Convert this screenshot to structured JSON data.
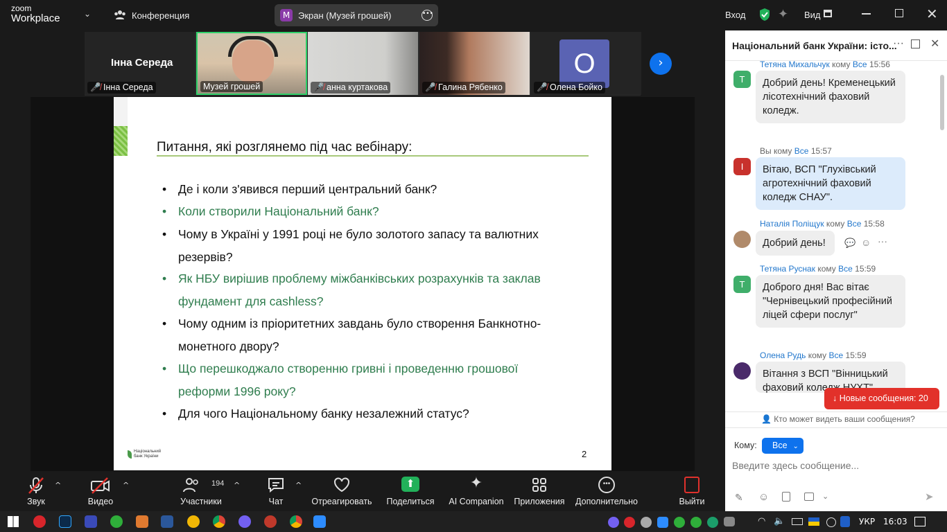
{
  "topbar": {
    "logo_line1": "zoom",
    "logo_line2": "Workplace",
    "conference": "Конференция",
    "share_badge": "M",
    "share_title": "Экран (Музей грошей)",
    "signin": "Вход",
    "view": "Вид"
  },
  "participants": [
    {
      "name": "Інна Середа",
      "display": "Інна Середа",
      "muted": true
    },
    {
      "name": "Музей грошей",
      "muted": false
    },
    {
      "name": "анна куртакова",
      "muted": true
    },
    {
      "name": "Галина Рябенко",
      "muted": true
    },
    {
      "name": "Олена Бойко",
      "initial": "О",
      "muted": true
    }
  ],
  "slide": {
    "title": "Питання, які розглянемо під час вебінару:",
    "bullets": [
      {
        "text": "Де і коли з'явився перший центральний банк?",
        "color": "#111111"
      },
      {
        "text": "Коли створили Національний банк?",
        "color": "#2f7d4e"
      },
      {
        "text": "Чому в Україні у 1991 році не було золотого запасу та валютних резервів?",
        "color": "#111111"
      },
      {
        "text": "Як НБУ вирішив проблему міжбанківських розрахунків та заклав фундамент для cashless?",
        "color": "#2f7d4e"
      },
      {
        "text": "Чому одним із пріоритетних завдань було створення Банкнотно-монетного двору?",
        "color": "#111111"
      },
      {
        "text": "Що перешкоджало створенню гривні і проведенню грошової реформи 1996 року?",
        "color": "#2f7d4e"
      },
      {
        "text": "Для чого Національному банку незалежний статус?",
        "color": "#111111"
      }
    ],
    "logo_text_1": "Національний",
    "logo_text_2": "банк України",
    "page_number": "2"
  },
  "chat": {
    "title": "Національний банк України: істо...",
    "messages": [
      {
        "sender": "Тетяна Михальчук",
        "to_word": "кому",
        "audience": "Все",
        "time": "15:56",
        "avatar": "T",
        "avatar_color": "#3fae6a",
        "text": "Добрий день! Кременецький лісотехнічний фаховий коледж."
      },
      {
        "sender": "Вы",
        "to_word": "кому",
        "audience": "Все",
        "time": "15:57",
        "avatar": "I",
        "avatar_color": "#c8312c",
        "text": "Вітаю, ВСП \"Глухівський агротехнічний фаховий коледж СНАУ\"."
      },
      {
        "sender": "Наталія Поліщук",
        "to_word": "кому",
        "audience": "Все",
        "time": "15:58",
        "avatar": "",
        "avatar_color": "#b08a6a",
        "text": "Добрий день!"
      },
      {
        "sender": "Тетяна Руснак",
        "to_word": "кому",
        "audience": "Все",
        "time": "15:59",
        "avatar": "T",
        "avatar_color": "#3fae6a",
        "text": "Доброго дня! Вас вітає \"Чернівецький професійний ліцей сфери послуг\""
      },
      {
        "sender": "Олена Рудь",
        "to_word": "кому",
        "audience": "Все",
        "time": "15:59",
        "avatar": "",
        "avatar_color": "#4a2a6a",
        "text": "Вітання з ВСП \"Вінницький фаховий коледж НУХТ\""
      }
    ],
    "new_messages": "Новые сообщения: 20",
    "who_can_see": "Кто может видеть ваши сообщения?",
    "to_label": "Кому:",
    "to_value": "Все",
    "input_placeholder": "Введите здесь сообщение..."
  },
  "toolbar": {
    "audio": "Звук",
    "video": "Видео",
    "participants": "Участники",
    "participants_count": "194",
    "chat": "Чат",
    "react": "Отреагировать",
    "share": "Поделиться",
    "ai": "AI Companion",
    "apps": "Приложения",
    "more": "Дополнительно",
    "leave": "Выйти"
  },
  "taskbar": {
    "lang": "УКР",
    "time": "16:03"
  }
}
